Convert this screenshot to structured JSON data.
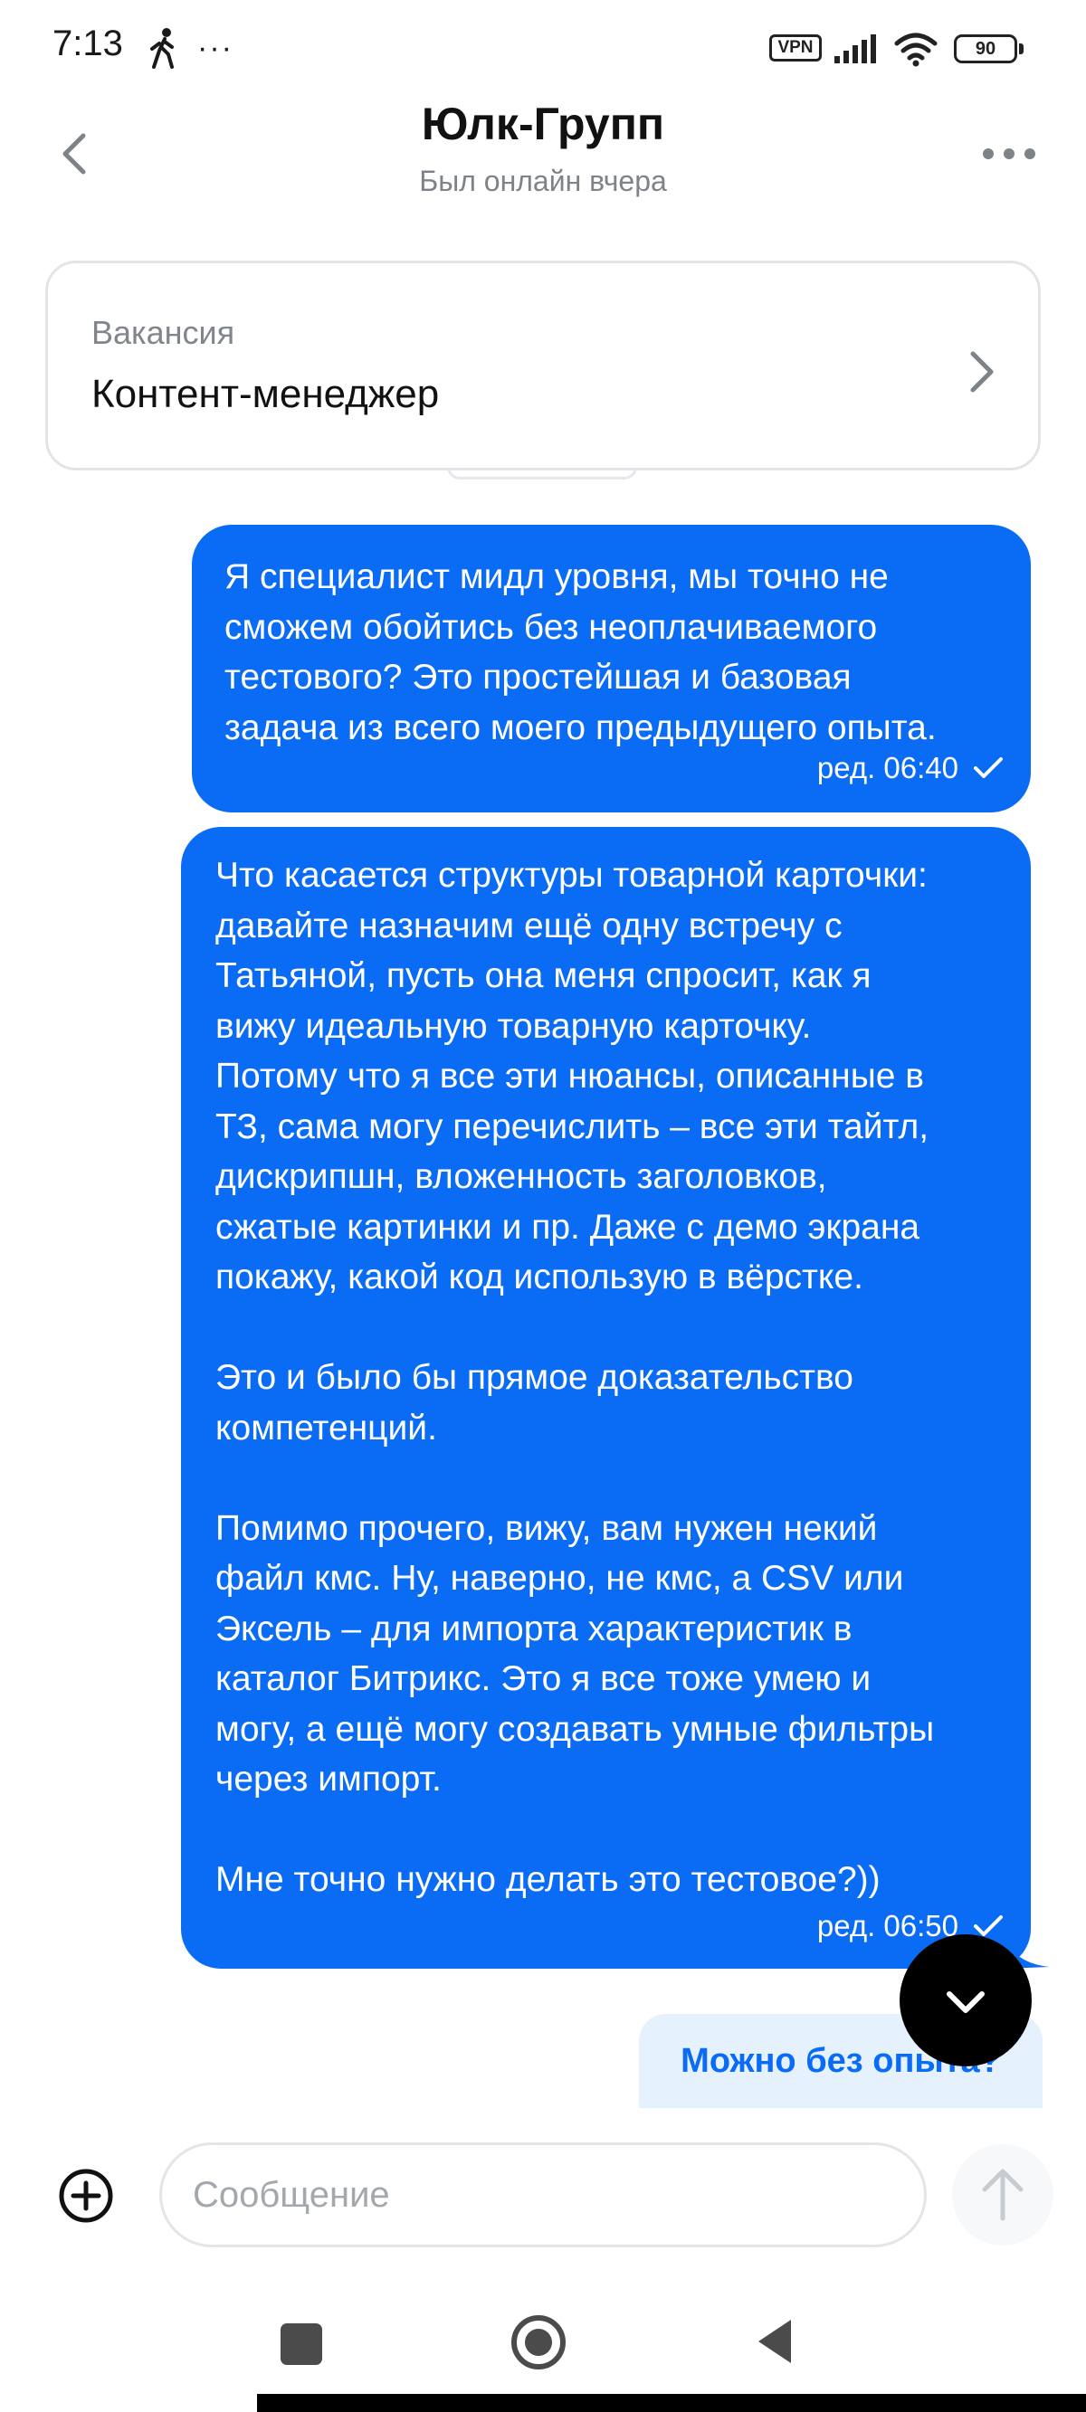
{
  "status_bar": {
    "time": "7:13",
    "extra_dots": "···",
    "vpn": "VPN",
    "battery": "90"
  },
  "header": {
    "title": "Юлк-Групп",
    "subtitle": "Был онлайн вчера"
  },
  "vacancy": {
    "label": "Вакансия",
    "value": "Контент-менеджер"
  },
  "messages": [
    {
      "text": "Я специалист мидл уровня, мы точно не\nсможем обойтись без неоплачиваемого\nтестового? Это простейшая и базовая\nзадача из всего моего предыдущего опыта.",
      "meta": "ред. 06:40"
    },
    {
      "text": "Что касается структуры товарной карточки:\nдавайте назначим ещё одну встречу с\nТатьяной, пусть она меня спросит, как я\nвижу идеальную товарную карточку.\nПотому что я все эти нюансы, описанные в\nТЗ, сама могу перечислить – все эти тайтл,\nдискрипшн, вложенность заголовков,\nсжатые картинки и пр. Даже с демо экрана\nпокажу, какой код использую в вёрстке.\n\nЭто и было бы прямое доказательство\nкомпетенций.\n\nПомимо прочего, вижу, вам нужен некий\nфайл кмс. Ну, наверно, не кмс, а CSV или\nЭксель – для импорта характеристик в\nкаталог Битрикс. Это я все тоже умею и\nмогу, а ещё могу создавать умные фильтры\nчерез импорт.\n\nМне точно нужно делать это тестовое?))",
      "meta": "ред. 06:50"
    }
  ],
  "quick_reply": "Можно без опыта?",
  "input": {
    "placeholder": "Сообщение",
    "value": ""
  },
  "colors": {
    "accent": "#0a6cf5",
    "quick_reply_bg": "#e6f1fe",
    "muted_text": "#7d8388"
  },
  "icons": {
    "back": "chevron-left-icon",
    "menu": "more-horizontal-icon",
    "vacancy_open": "chevron-right-icon",
    "read": "checkmark-icon",
    "scroll_down": "chevron-down-icon",
    "attach": "plus-circle-icon",
    "send": "arrow-up-icon"
  }
}
